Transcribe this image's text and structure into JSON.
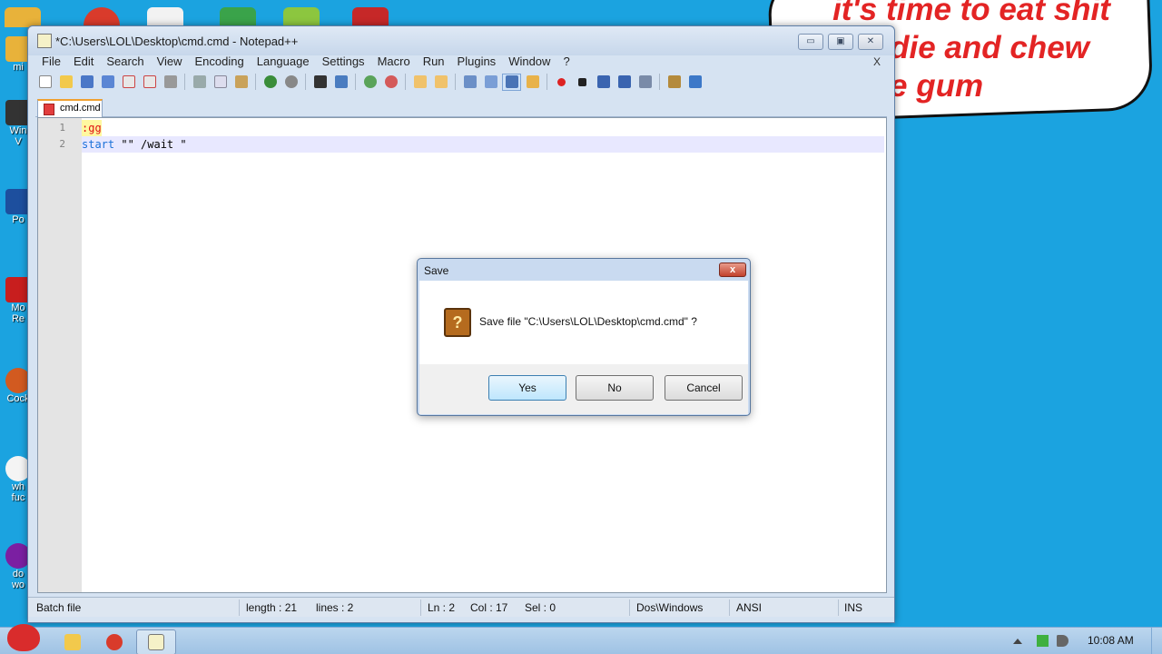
{
  "desktop": {
    "speech_bubble": [
      "it's time to eat shit",
      "die and chew",
      "e gum"
    ],
    "icons": [
      {
        "label": "mi"
      },
      {
        "label": "Win"
      },
      {
        "label": "V"
      },
      {
        "label": "Po"
      },
      {
        "label": "Mo"
      },
      {
        "label": "Re"
      },
      {
        "label": "Cock"
      },
      {
        "label": "wh"
      },
      {
        "label": "fuc"
      },
      {
        "label": "do"
      },
      {
        "label": "wo"
      }
    ]
  },
  "window": {
    "title": "*C:\\Users\\LOL\\Desktop\\cmd.cmd - Notepad++",
    "minimize": "▭",
    "restore": "▣",
    "close": "✕",
    "menu_close": "X"
  },
  "menu": [
    "File",
    "Edit",
    "Search",
    "View",
    "Encoding",
    "Language",
    "Settings",
    "Macro",
    "Run",
    "Plugins",
    "Window",
    "?"
  ],
  "tab": {
    "label": "cmd.cmd"
  },
  "editor": {
    "lines": [
      {
        "num": "1",
        "text": ":gg"
      },
      {
        "num": "2",
        "keyword": "start",
        "rest": " \"\" /wait \""
      }
    ]
  },
  "status": {
    "lang": "Batch file",
    "length": "length : 21",
    "lines": "lines : 2",
    "ln": "Ln : 2",
    "col": "Col : 17",
    "sel": "Sel : 0",
    "eol": "Dos\\Windows",
    "encoding": "ANSI",
    "mode": "INS"
  },
  "dialog": {
    "title": "Save",
    "close": "x",
    "message": "Save file \"C:\\Users\\LOL\\Desktop\\cmd.cmd\" ?",
    "icon_glyph": "?",
    "yes": "Yes",
    "no": "No",
    "cancel": "Cancel"
  },
  "taskbar": {
    "clock": "10:08 AM"
  },
  "colors": {
    "desktop": "#1ba3e0",
    "speech_text": "#e32424",
    "editor_label": "#e01010",
    "editor_keyword": "#1a70d8",
    "dialog_close": "#c2412c"
  }
}
